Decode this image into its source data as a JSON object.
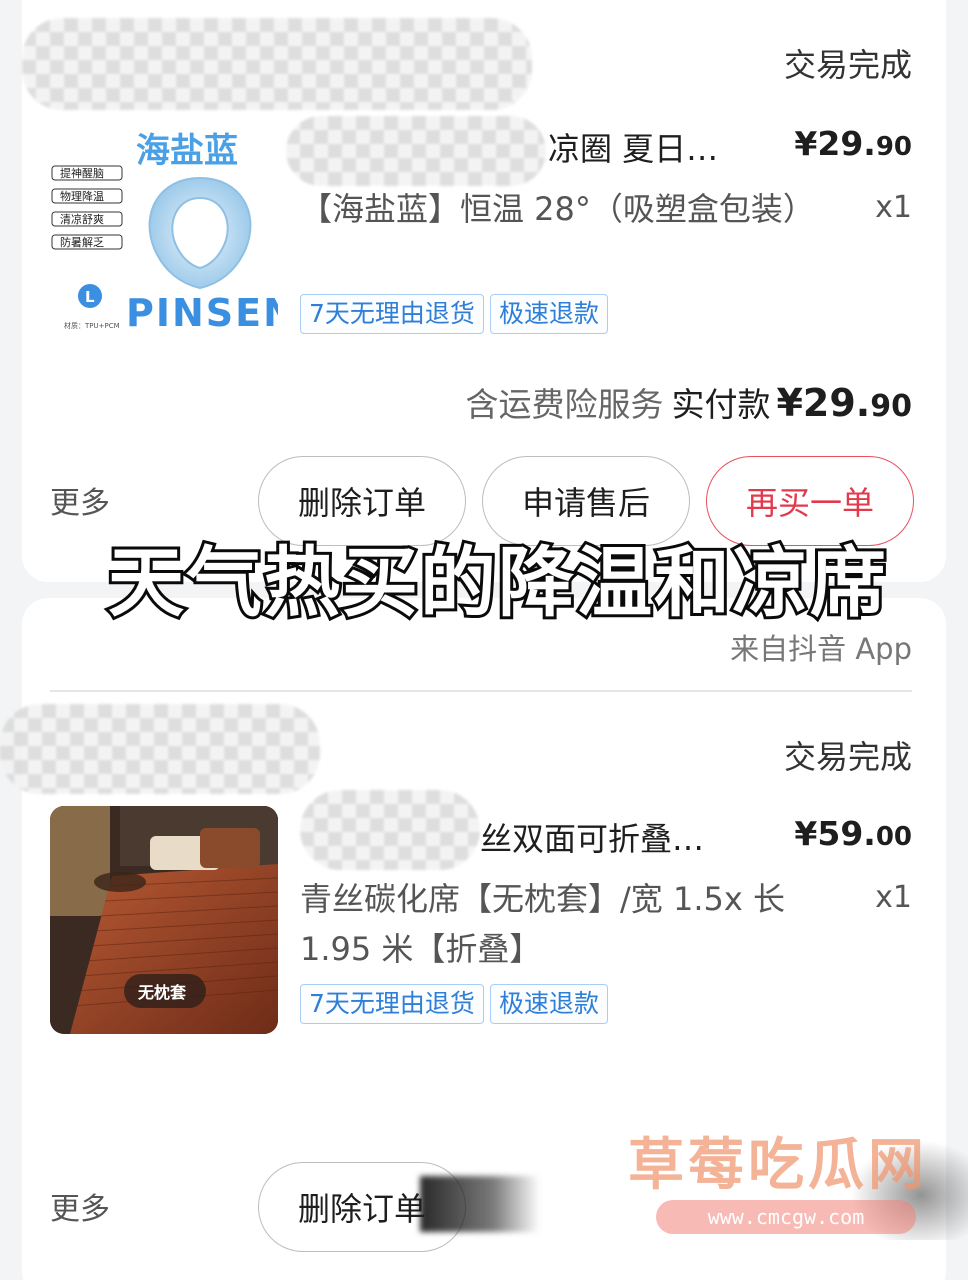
{
  "orders": [
    {
      "status": "交易完成",
      "thumb": {
        "brand_cn": "海盐蓝",
        "brand_en": "PINSEN",
        "size_badge": "L",
        "features": [
          "提神醒脑",
          "物理降温",
          "清凉舒爽",
          "防暑解乏"
        ],
        "material": "材质：TPU+PCM"
      },
      "title": "凉圈 夏日…",
      "price_main": "¥29.",
      "price_dec": "90",
      "spec": "【海盐蓝】恒温 28°（吸塑盒包装）",
      "qty": "x1",
      "tags": [
        "7天无理由退货",
        "极速退款"
      ],
      "summary": {
        "service": "含运费险服务",
        "paid_label": "实付款",
        "amount_main": "¥29.",
        "amount_dec": "90"
      },
      "more": "更多",
      "buttons": [
        "删除订单",
        "申请售后",
        "再买一单"
      ]
    },
    {
      "source": "来自抖音 App",
      "status": "交易完成",
      "thumb": {
        "badge": "无枕套"
      },
      "title": "丝双面可折叠…",
      "price_main": "¥59.",
      "price_dec": "00",
      "spec": "青丝碳化席【无枕套】/宽 1.5x 长 1.95 米【折叠】",
      "qty": "x1",
      "tags": [
        "7天无理由退货",
        "极速退款"
      ],
      "more": "更多",
      "buttons": [
        "删除订单"
      ]
    }
  ],
  "overlay_caption": "天气热买的降温和凉席",
  "watermark": {
    "title": "草莓吃瓜网",
    "url": "www.cmcgw.com"
  },
  "colors": {
    "accent_red": "#e23a4d",
    "tag_blue": "#2f7fd8",
    "thumb_blue": "#3a8fe0"
  }
}
